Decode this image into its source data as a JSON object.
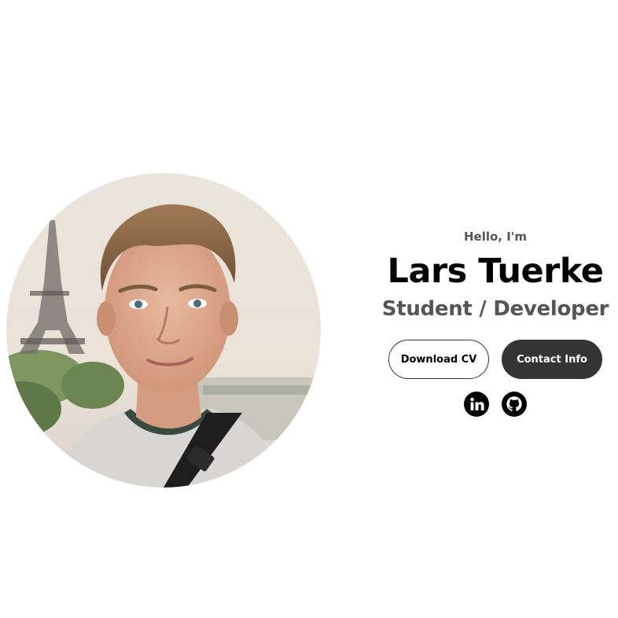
{
  "profile": {
    "photo": "profile-photo-portrait"
  },
  "intro": {
    "greeting": "Hello, I'm",
    "name": "Lars Tuerke",
    "role": "Student / Developer"
  },
  "buttons": {
    "download_cv": "Download CV",
    "contact_info": "Contact Info"
  },
  "socials": [
    {
      "icon": "linkedin-icon"
    },
    {
      "icon": "github-icon"
    }
  ],
  "colors": {
    "background": "#ffffff",
    "primary_text": "#000000",
    "secondary_text": "#555555",
    "button_dark": "#353535"
  }
}
